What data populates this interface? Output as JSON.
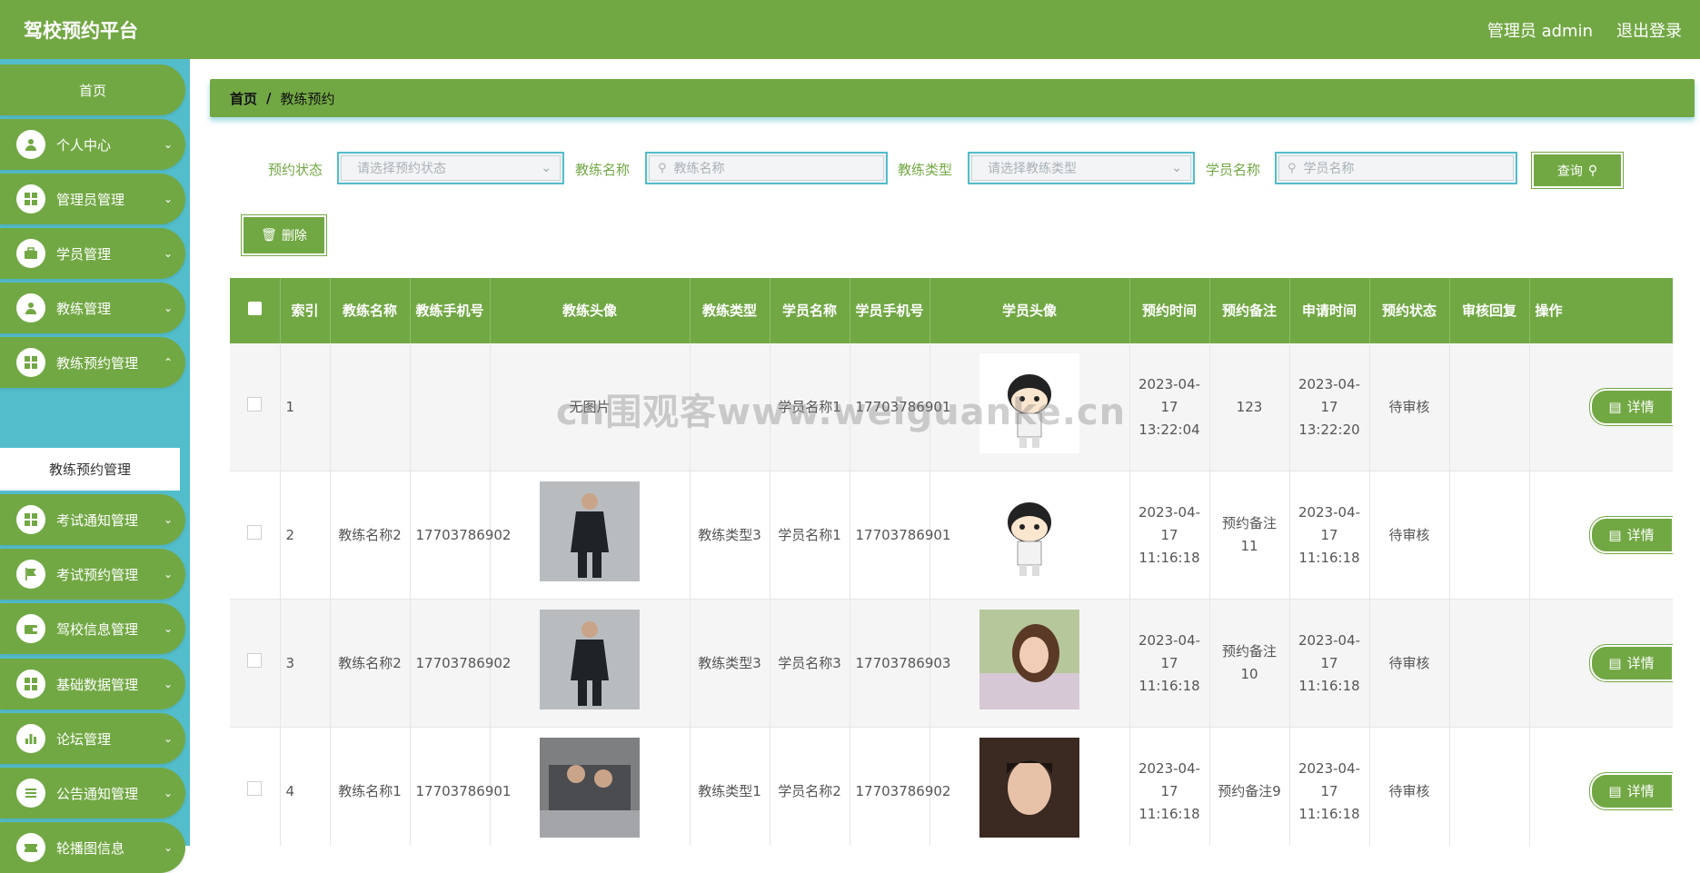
{
  "header": {
    "brand": "驾校预约平台",
    "user": "管理员 admin",
    "logout": "退出登录"
  },
  "sidebar": {
    "home": "首页",
    "items": [
      {
        "label": "个人中心",
        "icon": "user-icon"
      },
      {
        "label": "管理员管理",
        "icon": "grid-icon"
      },
      {
        "label": "学员管理",
        "icon": "briefcase-icon"
      },
      {
        "label": "教练管理",
        "icon": "user-icon"
      },
      {
        "label": "教练预约管理",
        "icon": "grid-icon"
      },
      {
        "label": "考试通知管理",
        "icon": "grid-icon"
      },
      {
        "label": "考试预约管理",
        "icon": "flag-icon"
      },
      {
        "label": "驾校信息管理",
        "icon": "wallet-icon"
      },
      {
        "label": "基础数据管理",
        "icon": "grid-icon"
      },
      {
        "label": "论坛管理",
        "icon": "chart-icon"
      },
      {
        "label": "公告通知管理",
        "icon": "list-icon"
      },
      {
        "label": "轮播图信息",
        "icon": "ticket-icon"
      }
    ],
    "submenu": "教练预约管理"
  },
  "breadcrumb": {
    "home": "首页",
    "sep": "/",
    "current": "教练预约"
  },
  "filters": {
    "status_label": "预约状态",
    "status_placeholder": "请选择预约状态",
    "coach_label": "教练名称",
    "coach_placeholder": "教练名称",
    "type_label": "教练类型",
    "type_placeholder": "请选择教练类型",
    "student_label": "学员名称",
    "student_placeholder": "学员名称",
    "search_button": "查询"
  },
  "actions": {
    "delete_button": "删除"
  },
  "table": {
    "headers": [
      "",
      "索引",
      "教练名称",
      "教练手机号",
      "教练头像",
      "教练类型",
      "学员名称",
      "学员手机号",
      "学员头像",
      "预约时间",
      "预约备注",
      "申请时间",
      "预约状态",
      "审核回复",
      "操作"
    ],
    "rows": [
      {
        "index": "1",
        "coach_name": "",
        "coach_phone": "",
        "coach_avatar": "无图片",
        "coach_type": "",
        "student_name": "学员名称1",
        "student_phone": "17703786901",
        "appoint_time": "2023-04-17 13:22:04",
        "note": "123",
        "apply_time": "2023-04-17 13:22:20",
        "status": "待审核",
        "reply": "",
        "action": "详情"
      },
      {
        "index": "2",
        "coach_name": "教练名称2",
        "coach_phone": "17703786902",
        "coach_avatar": "",
        "coach_type": "教练类型3",
        "student_name": "学员名称1",
        "student_phone": "17703786901",
        "appoint_time": "2023-04-17 11:16:18",
        "note": "预约备注11",
        "apply_time": "2023-04-17 11:16:18",
        "status": "待审核",
        "reply": "",
        "action": "详情"
      },
      {
        "index": "3",
        "coach_name": "教练名称2",
        "coach_phone": "17703786902",
        "coach_avatar": "",
        "coach_type": "教练类型3",
        "student_name": "学员名称3",
        "student_phone": "17703786903",
        "appoint_time": "2023-04-17 11:16:18",
        "note": "预约备注10",
        "apply_time": "2023-04-17 11:16:18",
        "status": "待审核",
        "reply": "",
        "action": "详情"
      },
      {
        "index": "4",
        "coach_name": "教练名称1",
        "coach_phone": "17703786901",
        "coach_avatar": "",
        "coach_type": "教练类型1",
        "student_name": "学员名称2",
        "student_phone": "17703786902",
        "appoint_time": "2023-04-17 11:16:18",
        "note": "预约备注9",
        "apply_time": "2023-04-17 11:16:18",
        "status": "待审核",
        "reply": "",
        "action": "详情"
      }
    ]
  },
  "watermark": "cn围观客www.weiguanke.cn",
  "colors": {
    "primary": "#72a844",
    "sidebar_bg": "#53bdcb"
  }
}
